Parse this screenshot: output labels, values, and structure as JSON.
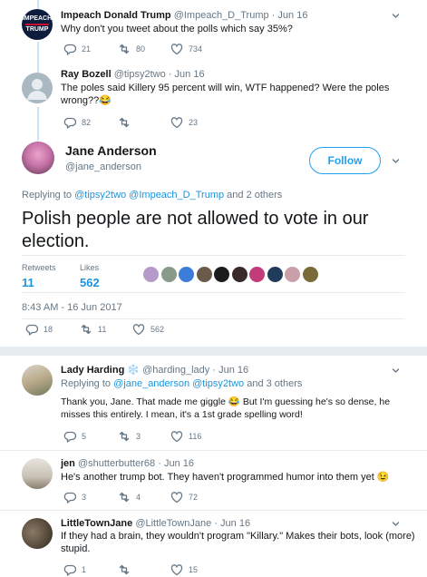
{
  "tweets_above": [
    {
      "name": "Impeach Donald Trump",
      "handle": "@Impeach_D_Trump",
      "time": "Jun 16",
      "text": "Why don't you tweet about the polls which say 35%?",
      "avatar_text": [
        "IMPEACH",
        "TRUMP"
      ],
      "replies": "21",
      "retweets": "80",
      "likes": "734"
    },
    {
      "name": "Ray Bozell",
      "handle": "@tipsy2two",
      "time": "Jun 16",
      "text_line1": "The poles said Killery 95 percent will win, WTF happened? Were the poles",
      "text_line2": "wrong??",
      "emoji": "😂",
      "replies": "82",
      "retweets": "",
      "likes": "23"
    }
  ],
  "main": {
    "name": "Jane Anderson",
    "handle": "@jane_anderson",
    "follow_label": "Follow",
    "replying_prefix": "Replying to",
    "replying_links": "@tipsy2two @Impeach_D_Trump",
    "replying_suffix": "and 2 others",
    "text": "Polish people are not allowed to vote in our election.",
    "retweets_label": "Retweets",
    "retweets_value": "11",
    "likes_label": "Likes",
    "likes_value": "562",
    "timestamp": "8:43 AM - 16 Jun 2017",
    "replies": "18",
    "retweets": "11",
    "likes": "562",
    "liker_colors": [
      "#b59ac9",
      "#8a9a8a",
      "#3b7dd8",
      "#6b5a4a",
      "#1c1c1c",
      "#3a2a2a",
      "#c23b7a",
      "#203c5a",
      "#c9a0a8",
      "#7a6a3a"
    ]
  },
  "replies": [
    {
      "name": "Lady Harding",
      "badge": "❄️",
      "handle": "@harding_lady",
      "time": "Jun 16",
      "replying_prefix": "Replying to",
      "replying_links": "@jane_anderson @tipsy2two",
      "replying_suffix": "and 3 others",
      "text_line1_a": "Thank you, Jane. That made me giggle",
      "emoji": "😂",
      "text_line1_b": "But I'm guessing he's so dense, he",
      "text_line2": "misses this entirely. I mean, it's a 1st grade spelling word!",
      "replies": "5",
      "retweets": "3",
      "likes": "116"
    },
    {
      "name": "jen",
      "handle": "@shutterbutter68",
      "time": "Jun 16",
      "text": "He's another trump bot.  They haven't programmed humor into them yet",
      "emoji": "😉",
      "replies": "3",
      "retweets": "4",
      "likes": "72"
    },
    {
      "name": "LittleTownJane",
      "handle": "@LittleTownJane",
      "time": "Jun 16",
      "text_line1": "If they had a brain, they wouldn't program \"Killary.\"  Makes their bots,  look (more)",
      "text_line2": "stupid.",
      "replies": "1",
      "retweets": "",
      "likes": "15"
    }
  ],
  "sep": "·",
  "colors": {
    "blue": "#1da1f2",
    "link": "#1b95e0",
    "gray": "#657786",
    "line": "#cce3f5",
    "divider": "#e6ecf0"
  }
}
